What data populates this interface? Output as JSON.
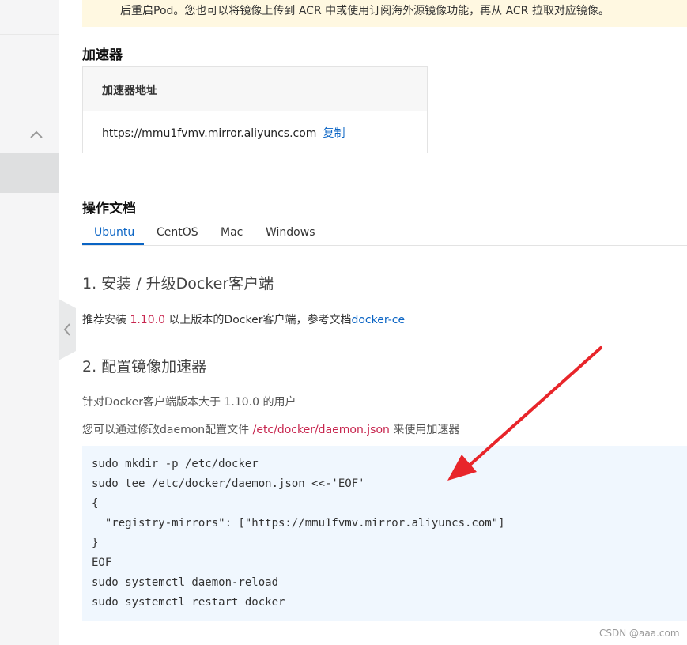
{
  "notice": {
    "text": "后重启Pod。您也可以将镜像上传到 ACR 中或使用订阅海外源镜像功能，再从 ACR 拉取对应镜像。"
  },
  "accelerator": {
    "section_title": "加速器",
    "table_header": "加速器地址",
    "url": "https://mmu1fvmv.mirror.aliyuncs.com",
    "copy_label": "复制"
  },
  "docs": {
    "section_title": "操作文档",
    "tabs": [
      {
        "label": "Ubuntu",
        "active": true
      },
      {
        "label": "CentOS",
        "active": false
      },
      {
        "label": "Mac",
        "active": false
      },
      {
        "label": "Windows",
        "active": false
      }
    ],
    "step1": {
      "title": "1. 安装 / 升级Docker客户端",
      "text_prefix": "推荐安装 ",
      "version": "1.10.0",
      "text_middle": " 以上版本的Docker客户端，参考文档",
      "link": "docker-ce"
    },
    "step2": {
      "title": "2. 配置镜像加速器",
      "line1": "针对Docker客户端版本大于 1.10.0 的用户",
      "line2_prefix": "您可以通过修改daemon配置文件 ",
      "line2_path": "/etc/docker/daemon.json",
      "line2_suffix": " 来使用加速器"
    },
    "code_lines": [
      "sudo mkdir -p /etc/docker",
      "sudo tee /etc/docker/daemon.json <<-'EOF'",
      "{",
      "  \"registry-mirrors\": [\"https://mmu1fvmv.mirror.aliyuncs.com\"]",
      "}",
      "EOF",
      "sudo systemctl daemon-reload",
      "sudo systemctl restart docker"
    ]
  },
  "watermark": "CSDN @aaa.com",
  "icons": {
    "collapse": "chevron-up-icon",
    "panel_toggle": "chevron-left-icon"
  },
  "colors": {
    "accent": "#0a64c4",
    "highlight": "#c7254e",
    "notice_bg": "#fff8e1",
    "code_bg": "#f0f7fe",
    "annotation_arrow": "#e8252a"
  }
}
